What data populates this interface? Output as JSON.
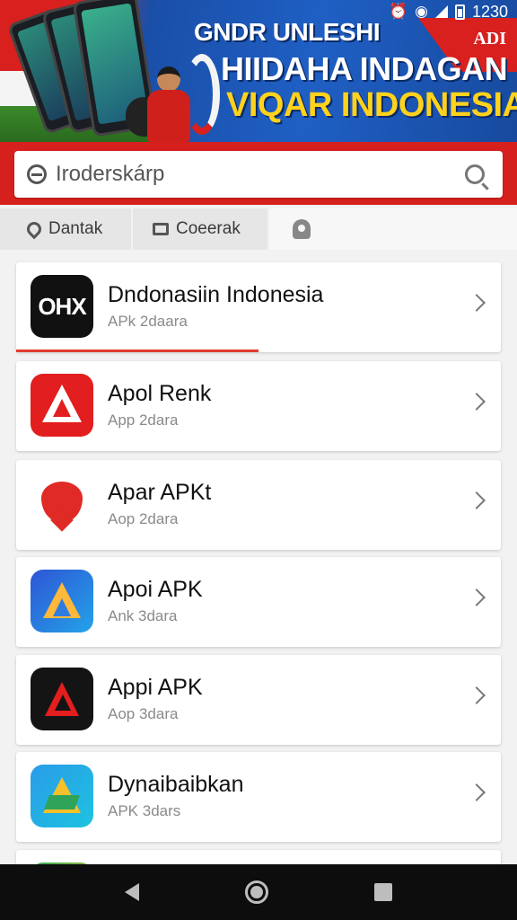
{
  "banner": {
    "line1": "GNDR UNLESHI",
    "line2": "HIIDAHA INDAGAN",
    "line3": "VIQAR INDONESIA",
    "corner_badge": "ADI"
  },
  "status_bar": {
    "time": "1230",
    "icons": [
      "alarm-icon",
      "wifi-icon",
      "signal-icon",
      "battery-icon"
    ]
  },
  "search": {
    "value": "Iroderskárp"
  },
  "tabs": [
    {
      "label": "Dantak",
      "icon": "location-pin-icon"
    },
    {
      "label": "Coeerak",
      "icon": "chat-icon"
    },
    {
      "label": "",
      "icon": "ghost-icon"
    }
  ],
  "apps": [
    {
      "name": "Dndonasiin Indonesia",
      "sub": "APk 2daara",
      "icon_text": "OHX",
      "progress": 0.5
    },
    {
      "name": "Apol Renk",
      "sub": "App 2dara"
    },
    {
      "name": "Apar APKt",
      "sub": "Aop 2dara"
    },
    {
      "name": "Apoi APK",
      "sub": "Ank 3dara"
    },
    {
      "name": "Appi APK",
      "sub": "Aop 3dara"
    },
    {
      "name": "Dynaibaibkan",
      "sub": "APK 3dars"
    }
  ],
  "colors": {
    "accent_red": "#d6201d",
    "banner_blue": "#1f5fc4",
    "banner_yellow": "#ffd21c"
  }
}
